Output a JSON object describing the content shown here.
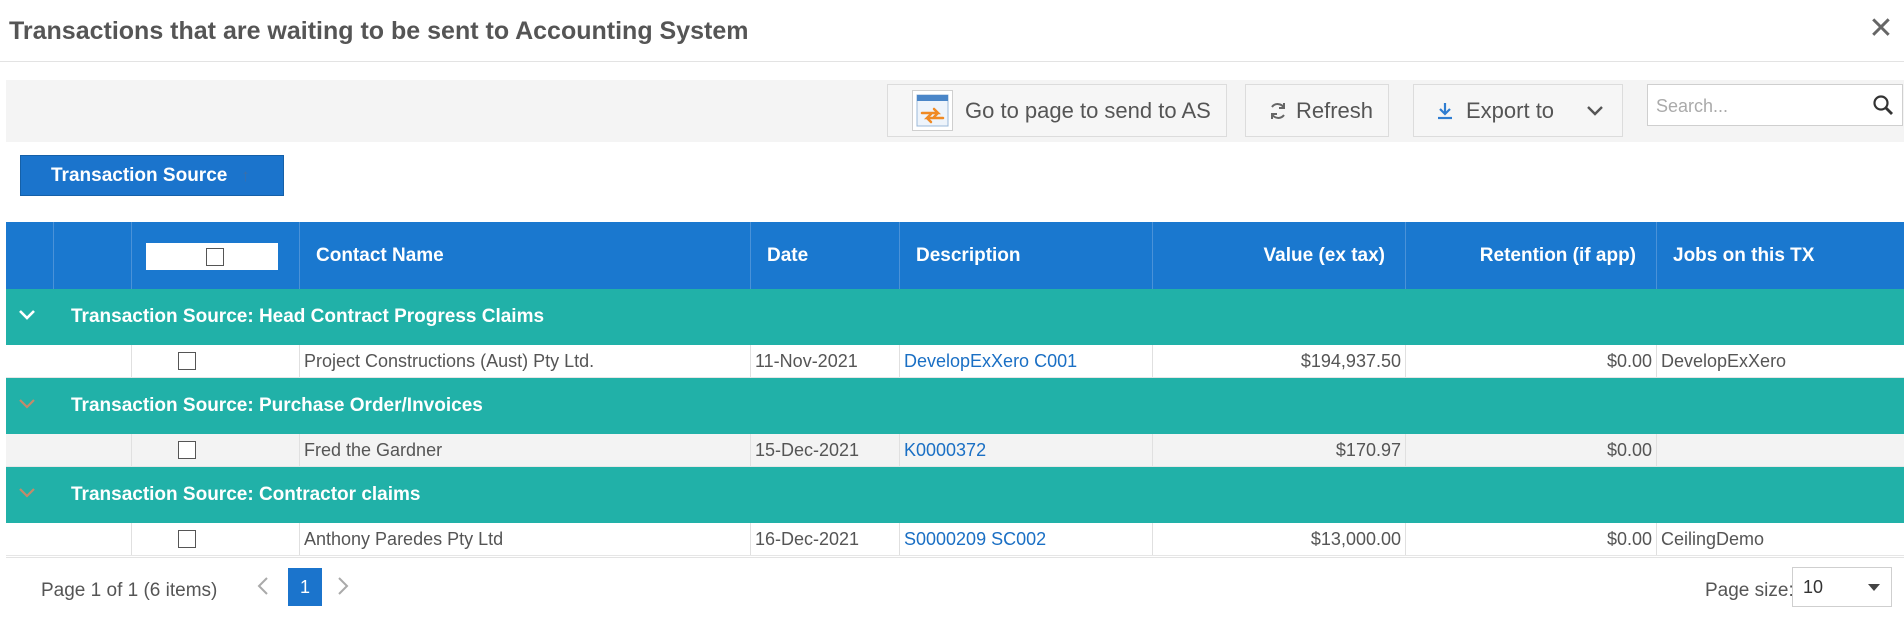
{
  "dialog": {
    "title": "Transactions that are waiting to be sent to Accounting System",
    "close_icon": "close-icon"
  },
  "toolbar": {
    "goto_label": "Go to page to send to AS",
    "refresh_label": "Refresh",
    "export_label": "Export to",
    "search_placeholder": "Search..."
  },
  "grouping": {
    "chip_label": "Transaction Source",
    "sort_indicator": "↑"
  },
  "grid": {
    "columns": {
      "contact_name": "Contact Name",
      "date": "Date",
      "description": "Description",
      "value": "Value (ex tax)",
      "retention": "Retention (if app)",
      "jobs": "Jobs on this TX"
    },
    "groups": [
      {
        "label": "Transaction Source: Head Contract Progress Claims",
        "rows": [
          {
            "contact": "Project Constructions (Aust) Pty Ltd.",
            "date": "11-Nov-2021",
            "description": "DevelopExXero C001",
            "value": "$194,937.50",
            "retention": "$0.00",
            "jobs": "DevelopExXero"
          }
        ]
      },
      {
        "label": "Transaction Source: Purchase Order/Invoices",
        "rows": [
          {
            "contact": "Fred the Gardner",
            "date": "15-Dec-2021",
            "description": "K0000372",
            "value": "$170.97",
            "retention": "$0.00",
            "jobs": ""
          }
        ]
      },
      {
        "label": "Transaction Source: Contractor claims",
        "rows": [
          {
            "contact": "Anthony Paredes Pty Ltd",
            "date": "16-Dec-2021",
            "description": "S0000209 SC002",
            "value": "$13,000.00",
            "retention": "$0.00",
            "jobs": "CeilingDemo"
          }
        ]
      }
    ]
  },
  "pager": {
    "info": "Page 1 of 1 (6 items)",
    "current_page": "1",
    "page_size_label": "Page size:",
    "page_size_value": "10"
  },
  "colors": {
    "header_blue": "#1a78cf",
    "group_teal": "#21b1a8",
    "accent_blue": "#1b74cc",
    "link_blue": "#1a6fc4"
  }
}
